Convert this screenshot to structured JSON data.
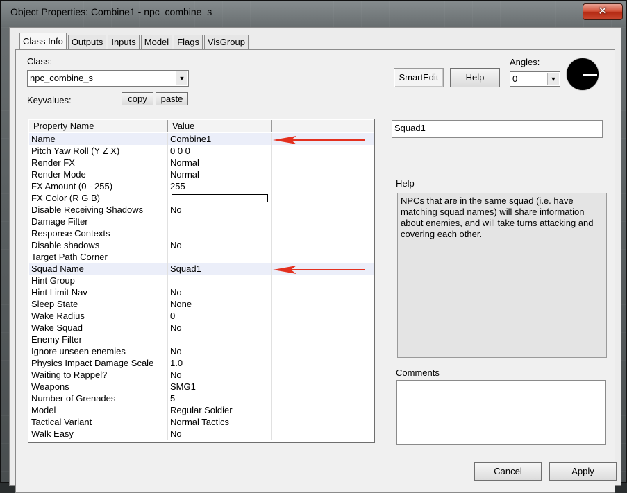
{
  "window": {
    "title": "Object Properties: Combine1 - npc_combine_s",
    "close_glyph": "✕"
  },
  "tabs": [
    {
      "label": "Class Info",
      "active": true
    },
    {
      "label": "Outputs"
    },
    {
      "label": "Inputs"
    },
    {
      "label": "Model"
    },
    {
      "label": "Flags"
    },
    {
      "label": "VisGroup"
    }
  ],
  "class_info": {
    "class_label": "Class:",
    "class_value": "npc_combine_s",
    "keyvalues_label": "Keyvalues:",
    "copy_label": "copy",
    "paste_label": "paste",
    "smartedit_label": "SmartEdit",
    "help_button_label": "Help",
    "angles_label": "Angles:",
    "angles_value": "0"
  },
  "properties": {
    "headers": [
      "Property Name",
      "Value"
    ],
    "rows": [
      {
        "name": "Name",
        "value": "Combine1"
      },
      {
        "name": "Pitch Yaw Roll (Y Z X)",
        "value": "0 0 0"
      },
      {
        "name": "Render FX",
        "value": "Normal"
      },
      {
        "name": "Render Mode",
        "value": "Normal"
      },
      {
        "name": "FX Amount (0 - 255)",
        "value": "255"
      },
      {
        "name": "FX Color (R G B)",
        "value": ""
      },
      {
        "name": "Disable Receiving Shadows",
        "value": "No"
      },
      {
        "name": "Damage Filter",
        "value": ""
      },
      {
        "name": "Response Contexts",
        "value": ""
      },
      {
        "name": "Disable shadows",
        "value": "No"
      },
      {
        "name": "Target Path Corner",
        "value": ""
      },
      {
        "name": "Squad Name",
        "value": "Squad1"
      },
      {
        "name": "Hint Group",
        "value": ""
      },
      {
        "name": "Hint Limit Nav",
        "value": "No"
      },
      {
        "name": "Sleep State",
        "value": "None"
      },
      {
        "name": "Wake Radius",
        "value": "0"
      },
      {
        "name": "Wake Squad",
        "value": "No"
      },
      {
        "name": "Enemy Filter",
        "value": ""
      },
      {
        "name": "Ignore unseen enemies",
        "value": "No"
      },
      {
        "name": "Physics Impact Damage Scale",
        "value": "1.0"
      },
      {
        "name": "Waiting to Rappel?",
        "value": "No"
      },
      {
        "name": "Weapons",
        "value": "SMG1"
      },
      {
        "name": "Number of Grenades",
        "value": "5"
      },
      {
        "name": "Model",
        "value": "Regular Soldier"
      },
      {
        "name": "Tactical Variant",
        "value": "Normal Tactics"
      },
      {
        "name": "Walk Easy",
        "value": "No"
      }
    ]
  },
  "value_edit": "Squad1",
  "help": {
    "label": "Help",
    "text": "NPCs that are in the same squad (i.e. have matching squad names) will share information about enemies, and will take turns attacking and covering each other."
  },
  "comments": {
    "label": "Comments",
    "value": ""
  },
  "footer": {
    "cancel_label": "Cancel",
    "apply_label": "Apply"
  },
  "colors": {
    "highlight_row": "#ebeef9",
    "annotation_arrow": "#e3301f",
    "close_button": "#c9472f"
  }
}
